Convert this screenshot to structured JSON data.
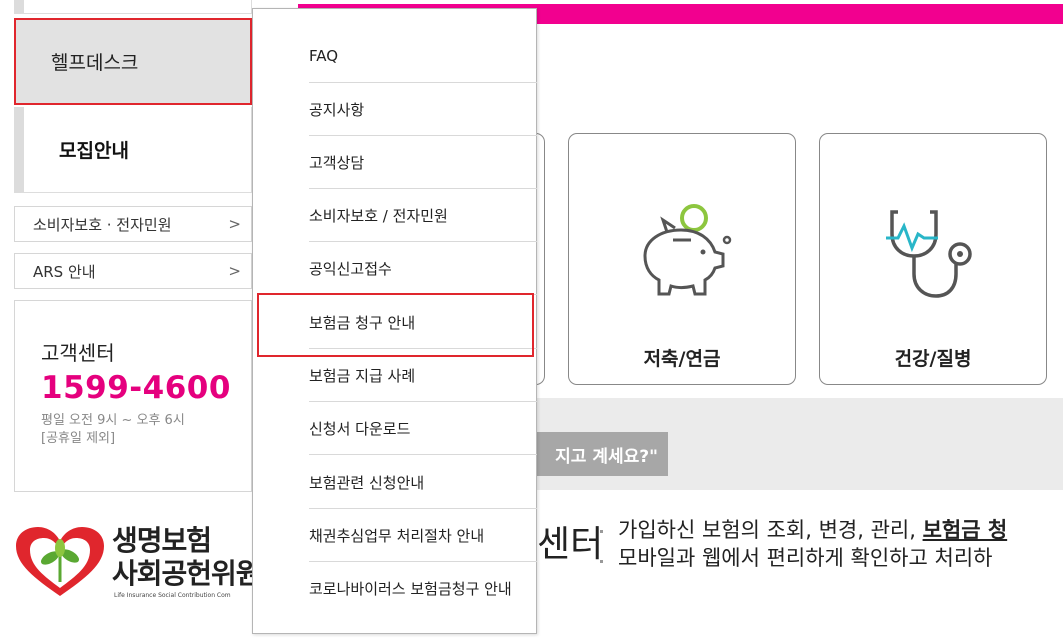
{
  "sidebar": {
    "helpdesk_label": "헬프데스크",
    "recruit_label": "모집안내",
    "consumer_link": "소비자보호 · 전자민원",
    "ars_link": "ARS 안내",
    "chevron": ">"
  },
  "customer_center": {
    "title": "고객센터",
    "phone": "1599-4600",
    "hours": "평일 오전 9시 ~ 오후 6시",
    "holiday_note": "[공휴일 제외]"
  },
  "logo": {
    "line1": "생명보험",
    "line2": "사회공헌위원",
    "sub": "Life Insurance Social Contribution Com"
  },
  "dropdown": {
    "items": [
      "FAQ",
      "공지사항",
      "고객상담",
      "소비자보호 / 전자민원",
      "공익신고접수",
      "보험금 청구 안내",
      "보험금 지급 사례",
      "신청서 다운로드",
      "보험관련 신청안내",
      "채권추심업무 처리절차 안내",
      "코로나바이러스 보험금청구 안내"
    ],
    "highlighted_index": 5
  },
  "cards": {
    "savings_label": "저축/연금",
    "health_label": "건강/질병"
  },
  "question_button": "지고 계세요?\"",
  "center_heading": "센터",
  "description": {
    "line1_prefix": "가입하신 보험의 조회, 변경, 관리, ",
    "line1_bold": "보험금 청",
    "line2": "모바일과 웹에서 편리하게 확인하고 처리하"
  },
  "colors": {
    "brand_pink": "#e5007e",
    "bar_pink": "#f2008f",
    "highlight_red": "#e0262d",
    "icon_green": "#8dc63f",
    "icon_teal": "#29b6c8"
  }
}
